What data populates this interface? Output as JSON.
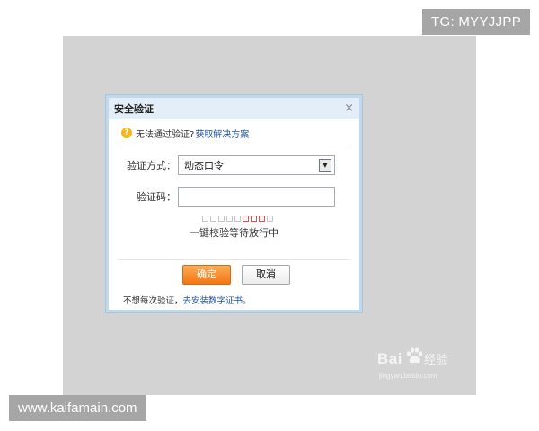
{
  "tags": {
    "top": "TG: MYYJJPP",
    "bottom": "www.kaifamain.com"
  },
  "dialog": {
    "title": "安全验证",
    "close_glyph": "×",
    "help": {
      "icon": "question-icon",
      "text": "无法通过验证?",
      "link": "获取解决方案"
    },
    "method": {
      "label": "验证方式：",
      "selected": "动态口令",
      "arrow": "▼"
    },
    "code": {
      "label": "验证码：",
      "value": "",
      "placeholder": ""
    },
    "progress": {
      "total_boxes": 9,
      "highlighted_boxes": [
        5,
        6,
        7
      ]
    },
    "wait_text": "一键校验等待放行中",
    "buttons": {
      "ok": "确定",
      "cancel": "取消"
    },
    "footer": {
      "text": "不想每次验证，",
      "link": "去安装数字证书",
      "suffix": "。"
    }
  },
  "watermark": {
    "brand": "Bai",
    "brand_suffix": "经验",
    "sub": "jingyan.baidu.com",
    "icon": "paw-icon"
  },
  "colors": {
    "overlay": "#d3d3d3",
    "accent_orange": "#f37512",
    "link_blue": "#1e50a2",
    "header_blue": "#e3eef8"
  }
}
